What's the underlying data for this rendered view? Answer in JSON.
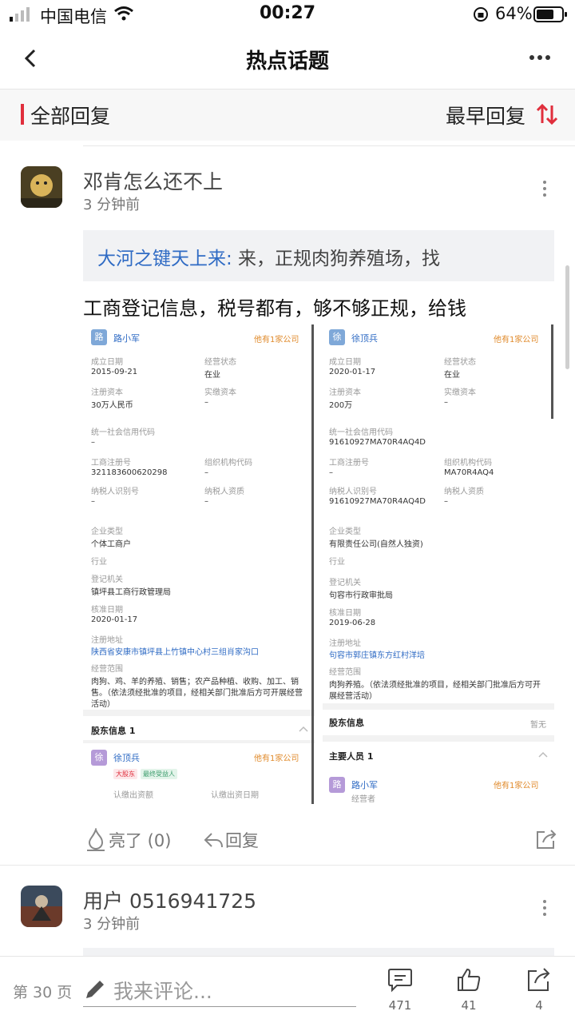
{
  "status_bar": {
    "carrier": "中国电信",
    "time": "00:27",
    "battery": "64%"
  },
  "header": {
    "title": "热点话题"
  },
  "filter": {
    "left_label": "全部回复",
    "sort_label": "最早回复"
  },
  "posts": [
    {
      "username": "邓肯怎么还不上",
      "time_ago": "3 分钟前",
      "quote_author": "大河之键天上来:",
      "quote_text": " 来，正规肉狗养殖场，找",
      "content": "工商登记信息，税号都有，够不够正规，给钱",
      "actions": {
        "like": "亮了 (0)",
        "reply": "回复"
      }
    },
    {
      "username": "用户 0516941725",
      "time_ago": "3 分钟前"
    }
  ],
  "screenshot": {
    "left": {
      "person_icon": "路",
      "person_name": "路小军",
      "badge": "他有1家公司",
      "f_found": "成立日期",
      "v_found": "2015-09-21",
      "f_status": "经营状态",
      "v_status": "在业",
      "f_capital": "注册资本",
      "v_capital": "30万人民币",
      "f_paid": "实缴资本",
      "v_paid": "–",
      "f_credit": "统一社会信用代码",
      "v_credit": "–",
      "f_reg": "工商注册号",
      "v_reg": "321183600620298",
      "f_org": "组织机构代码",
      "v_org": "–",
      "f_tax": "纳税人识别号",
      "v_tax": "–",
      "f_taxq": "纳税人资质",
      "v_taxq": "–",
      "f_type": "企业类型",
      "v_type": "个体工商户",
      "f_industry": "行业",
      "f_authority": "登记机关",
      "v_authority": "镇坪县工商行政管理局",
      "f_approve": "核准日期",
      "v_approve": "2020-01-17",
      "f_addr": "注册地址",
      "v_addr": "陕西省安康市镇坪县上竹镇中心村三组肖家沟口",
      "f_scope": "经营范围",
      "v_scope1": "肉狗、鸡、羊的养殖、销售；农产品种植、收购、加工、销",
      "v_scope2": "售。（依法须经批准的项目，经相关部门批准后方可开展经营",
      "v_scope3": "活动）",
      "sec_holder": "股东信息 1",
      "holder_icon": "徐",
      "holder_name": "徐顶兵",
      "holder_badge": "他有1家公司",
      "tag1": "大股东",
      "tag2": "最终受益人",
      "f_sub": "认缴出资额",
      "f_subdate": "认缴出资日期"
    },
    "right": {
      "person_icon": "徐",
      "person_name": "徐顶兵",
      "badge": "他有1家公司",
      "f_found": "成立日期",
      "v_found": "2020-01-17",
      "f_status": "经营状态",
      "v_status": "在业",
      "f_capital": "注册资本",
      "v_capital": "200万",
      "f_paid": "实缴资本",
      "v_paid": "–",
      "f_credit": "统一社会信用代码",
      "v_credit": "91610927MA70R4AQ4D",
      "f_reg": "工商注册号",
      "v_reg": "–",
      "f_org": "组织机构代码",
      "v_org": "MA70R4AQ4",
      "f_tax": "纳税人识别号",
      "v_tax": "91610927MA70R4AQ4D",
      "f_taxq": "纳税人资质",
      "v_taxq": "–",
      "f_type": "企业类型",
      "v_type": "有限责任公司(自然人独资)",
      "f_industry": "行业",
      "f_authority": "登记机关",
      "v_authority": "句容市行政审批局",
      "f_approve": "核准日期",
      "v_approve": "2019-06-28",
      "f_addr": "注册地址",
      "v_addr": "句容市郭庄镇东方红村洋培",
      "f_scope": "经营范围",
      "v_scope1": "肉狗养殖。（依法须经批准的项目，经相关部门批准后方可开",
      "v_scope2": "展经营活动）",
      "sec_holder": "股东信息",
      "holder_none": "暂无",
      "sec_staff": "主要人员 1",
      "staff_icon": "路",
      "staff_name": "路小军",
      "staff_badge": "他有1家公司",
      "staff_role": "经营者"
    }
  },
  "bottom_bar": {
    "page": "第 30 页",
    "placeholder": "我来评论...",
    "comments": "471",
    "likes": "41",
    "shares": "4"
  },
  "colors": {
    "accent": "#e02e3c",
    "link": "#2f6bc4",
    "badge": "#e08a2b"
  }
}
